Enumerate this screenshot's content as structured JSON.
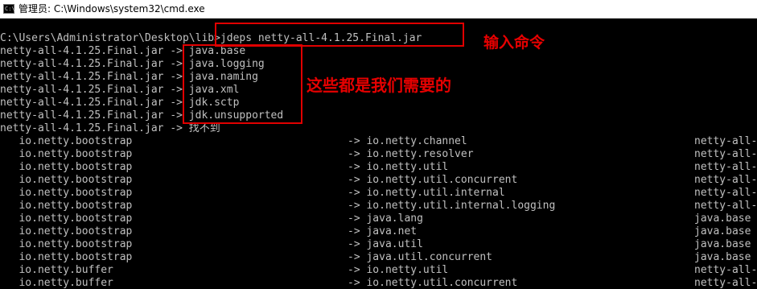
{
  "window": {
    "title": "管理员: C:\\Windows\\system32\\cmd.exe",
    "icon_glyph": "C:\\"
  },
  "console": {
    "prompt_line": "C:\\Users\\Administrator\\Desktop\\lib>jdeps netty-all-4.1.25.Final.jar",
    "module_deps": [
      "netty-all-4.1.25.Final.jar -> java.base",
      "netty-all-4.1.25.Final.jar -> java.logging",
      "netty-all-4.1.25.Final.jar -> java.naming",
      "netty-all-4.1.25.Final.jar -> java.xml",
      "netty-all-4.1.25.Final.jar -> jdk.sctp",
      "netty-all-4.1.25.Final.jar -> jdk.unsupported",
      "netty-all-4.1.25.Final.jar -> 找不到"
    ],
    "package_deps": [
      {
        "from": "   io.netty.bootstrap",
        "to": "-> io.netty.channel",
        "where": "netty-all-"
      },
      {
        "from": "   io.netty.bootstrap",
        "to": "-> io.netty.resolver",
        "where": "netty-all-"
      },
      {
        "from": "   io.netty.bootstrap",
        "to": "-> io.netty.util",
        "where": "netty-all-"
      },
      {
        "from": "   io.netty.bootstrap",
        "to": "-> io.netty.util.concurrent",
        "where": "netty-all-"
      },
      {
        "from": "   io.netty.bootstrap",
        "to": "-> io.netty.util.internal",
        "where": "netty-all-"
      },
      {
        "from": "   io.netty.bootstrap",
        "to": "-> io.netty.util.internal.logging",
        "where": "netty-all-"
      },
      {
        "from": "   io.netty.bootstrap",
        "to": "-> java.lang",
        "where": "java.base"
      },
      {
        "from": "   io.netty.bootstrap",
        "to": "-> java.net",
        "where": "java.base"
      },
      {
        "from": "   io.netty.bootstrap",
        "to": "-> java.util",
        "where": "java.base"
      },
      {
        "from": "   io.netty.bootstrap",
        "to": "-> java.util.concurrent",
        "where": "java.base"
      },
      {
        "from": "   io.netty.buffer",
        "to": "-> io.netty.util",
        "where": "netty-all-"
      },
      {
        "from": "   io.netty.buffer",
        "to": "-> io.netty.util.concurrent",
        "where": "netty-all-"
      }
    ]
  },
  "annotations": {
    "command_note": "输入命令",
    "modules_note": "这些都是我们需要的",
    "color": "#e60000"
  },
  "theme": {
    "console_background": "#000000",
    "console_text": "#c0c0c0"
  }
}
